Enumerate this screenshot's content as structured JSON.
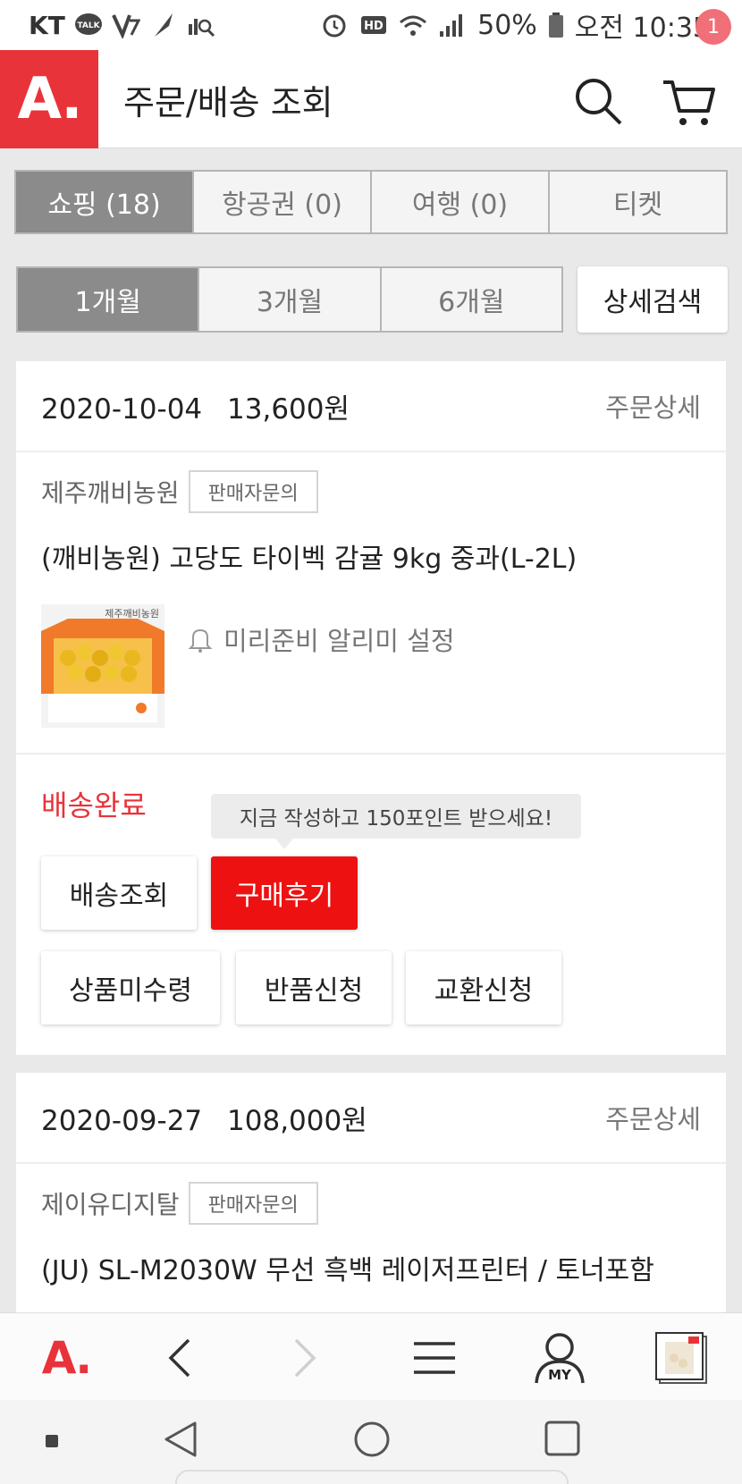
{
  "status_bar": {
    "carrier": "KT",
    "battery": "50%",
    "time": "오전 10:35"
  },
  "header": {
    "logo": "A.",
    "title": "주문/배송 조회",
    "cart_count": "1",
    "accent": "#e8333a"
  },
  "tabs": [
    {
      "label": "쇼핑 (18)",
      "active": true
    },
    {
      "label": "항공권 (0)",
      "active": false
    },
    {
      "label": "여행 (0)",
      "active": false
    },
    {
      "label": "티켓",
      "active": false
    }
  ],
  "periods": [
    {
      "label": "1개월",
      "active": true
    },
    {
      "label": "3개월",
      "active": false
    },
    {
      "label": "6개월",
      "active": false
    }
  ],
  "detail_search_label": "상세검색",
  "orders": [
    {
      "date": "2020-10-04",
      "amount": "13,600원",
      "detail_label": "주문상세",
      "seller": "제주깨비농원",
      "seller_ask_label": "판매자문의",
      "product": "(깨비농원) 고당도 타이벡 감귤 9kg 중과(L-2L)",
      "thumb_text": "제주깨비농원",
      "alarm_label": "미리준비 알리미 설정",
      "status": "배송완료",
      "tooltip": "지금 작성하고 150포인트 받으세요!",
      "buttons": {
        "track": "배송조회",
        "review": "구매후기",
        "not_received": "상품미수령",
        "return": "반품신청",
        "exchange": "교환신청"
      }
    },
    {
      "date": "2020-09-27",
      "amount": "108,000원",
      "detail_label": "주문상세",
      "seller": "제이유디지탈",
      "seller_ask_label": "판매자문의",
      "product": "(JU) SL-M2030W 무선 흑백 레이저프린터 / 토너포함"
    }
  ],
  "bottom_bar": {
    "logo": "A.",
    "my_label": "MY"
  },
  "icons": {
    "search": "search-icon",
    "cart": "cart-icon",
    "bell": "bell-icon",
    "back": "chevron-left-icon",
    "forward": "chevron-right-icon",
    "menu": "menu-icon",
    "my": "user-icon"
  }
}
